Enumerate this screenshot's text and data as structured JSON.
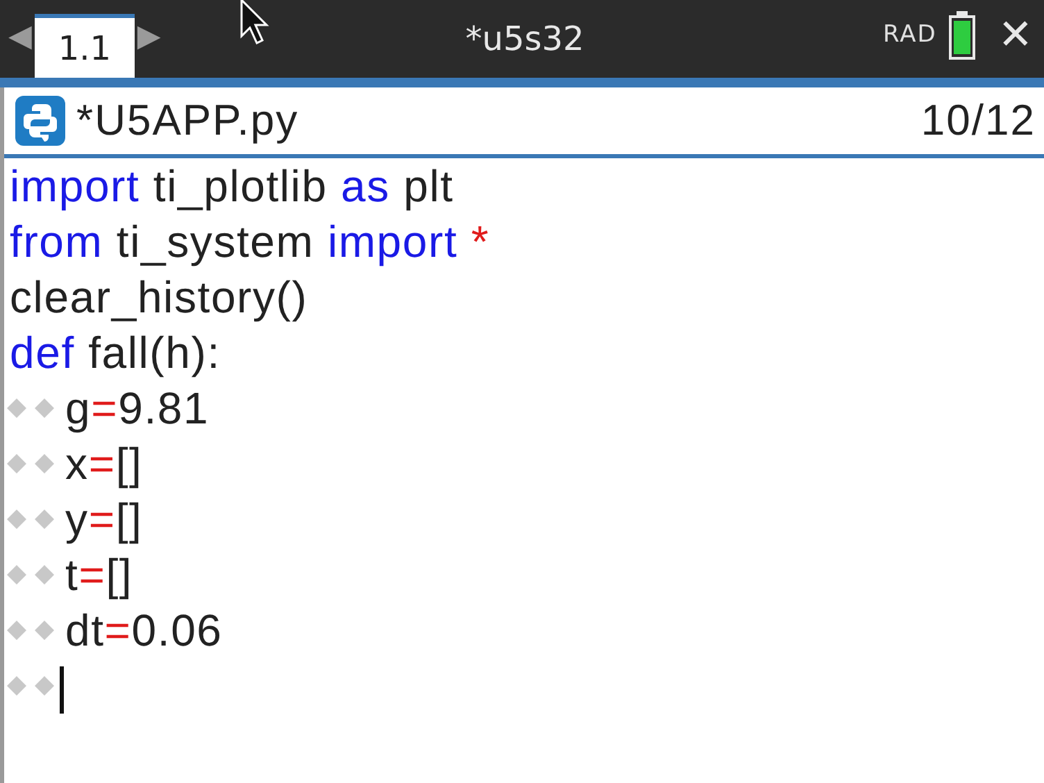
{
  "tab_bar": {
    "prev_arrow": "◀",
    "tab": {
      "label": "1.1",
      "selected": true
    },
    "next_arrow": "▶",
    "document_title": "*u5s32",
    "angle_mode": "RAD",
    "close": "✕"
  },
  "editor": {
    "file_name": "*U5APP.py",
    "line_position": "10/12",
    "lines": [
      {
        "tokens": [
          {
            "kind": "keyword",
            "text": "import"
          },
          {
            "kind": "plain",
            "text": " ti_plotlib "
          },
          {
            "kind": "keyword",
            "text": "as"
          },
          {
            "kind": "plain",
            "text": " plt"
          }
        ]
      },
      {
        "tokens": [
          {
            "kind": "keyword",
            "text": "from"
          },
          {
            "kind": "plain",
            "text": " ti_system "
          },
          {
            "kind": "keyword",
            "text": "import "
          },
          {
            "kind": "operator",
            "text": "*"
          }
        ]
      },
      {
        "tokens": [
          {
            "kind": "plain",
            "text": "clear_history()"
          }
        ]
      },
      {
        "tokens": [
          {
            "kind": "keyword",
            "text": "def"
          },
          {
            "kind": "plain",
            "text": " fall(h):"
          }
        ],
        "children": [
          {
            "cursor": false,
            "tokens": [
              {
                "kind": "plain",
                "text": "g"
              },
              {
                "kind": "operator",
                "text": "="
              },
              {
                "kind": "plain",
                "text": "9.81"
              }
            ]
          },
          {
            "cursor": false,
            "tokens": [
              {
                "kind": "plain",
                "text": "x"
              },
              {
                "kind": "operator",
                "text": "="
              },
              {
                "kind": "plain",
                "text": "[]"
              }
            ]
          },
          {
            "cursor": false,
            "tokens": [
              {
                "kind": "plain",
                "text": "y"
              },
              {
                "kind": "operator",
                "text": "="
              },
              {
                "kind": "plain",
                "text": "[]"
              }
            ]
          },
          {
            "cursor": false,
            "tokens": [
              {
                "kind": "plain",
                "text": "t"
              },
              {
                "kind": "operator",
                "text": "="
              },
              {
                "kind": "plain",
                "text": "[]"
              }
            ]
          },
          {
            "cursor": false,
            "tokens": [
              {
                "kind": "plain",
                "text": "dt"
              },
              {
                "kind": "operator",
                "text": "="
              },
              {
                "kind": "plain",
                "text": "0.06"
              }
            ]
          },
          {
            "cursor": true
          }
        ]
      }
    ]
  }
}
